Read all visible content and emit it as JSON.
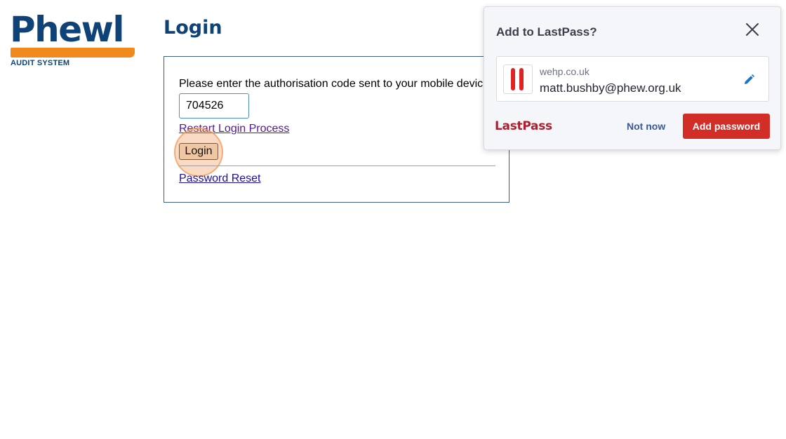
{
  "logo": {
    "wordmark": "Phewl",
    "subtitle": "AUDIT SYSTEM",
    "colors": {
      "blue": "#0f4277",
      "orange": "#f08a1c"
    }
  },
  "page": {
    "title": "Login"
  },
  "login_form": {
    "instruction": "Please enter the authorisation code sent to your mobile devic",
    "code_value": "704526",
    "restart_link": "Restart Login Process",
    "login_button": "Login",
    "reset_link": "Password Reset"
  },
  "lastpass_popup": {
    "title": "Add to LastPass?",
    "site": "wehp.co.uk",
    "username": "matt.bushby@phew.org.uk",
    "brand": "LastPass",
    "not_now_label": "Not now",
    "add_label": "Add password",
    "icons": {
      "close": "close-icon",
      "edit": "pencil-icon",
      "favicon": "site-favicon-icon"
    },
    "colors": {
      "accent_red": "#d32d27",
      "link_blue": "#3a5a94"
    }
  }
}
